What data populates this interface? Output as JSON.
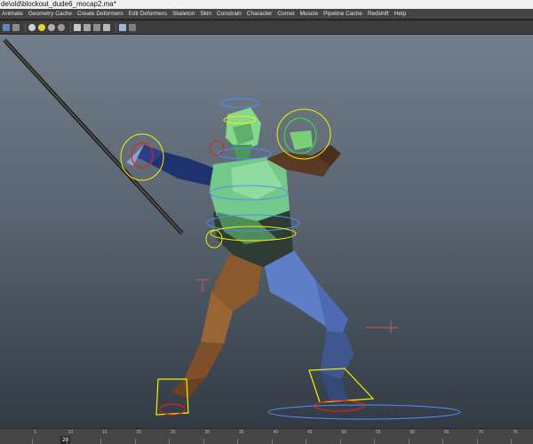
{
  "window": {
    "title": "de\\old\\blockout_dude6_mocap2.ma*"
  },
  "menubar": {
    "items": [
      "Animate",
      "Geometry Cache",
      "Create Deformers",
      "Edit Deformers",
      "Skeleton",
      "Skin",
      "Constrain",
      "Character",
      "Comet",
      "Muscle",
      "Pipeline Cache",
      "Redshift",
      "Help"
    ]
  },
  "toolbar": {
    "icons": [
      "camera-icon",
      "grid-icon",
      "shading-icon",
      "light-icon",
      "texture-icon",
      "isolate-icon",
      "xray-icon",
      "wireframe-icon",
      "display-icon",
      "resolution-icon",
      "camera-settings-icon"
    ]
  },
  "timeline": {
    "frame_labels": [
      "5",
      "10",
      "15",
      "20",
      "25",
      "30",
      "35",
      "40",
      "45",
      "50",
      "55",
      "60",
      "65",
      "70",
      "75"
    ],
    "current_frame": "20"
  },
  "colors": {
    "viewport_top": "#727e8a",
    "viewport_bottom": "#323b44",
    "ik_yellow": "#f2f200",
    "ctrl_red": "#e02020",
    "ctrl_blue": "#4a90ff",
    "ctrl_green": "#3fd64a"
  }
}
